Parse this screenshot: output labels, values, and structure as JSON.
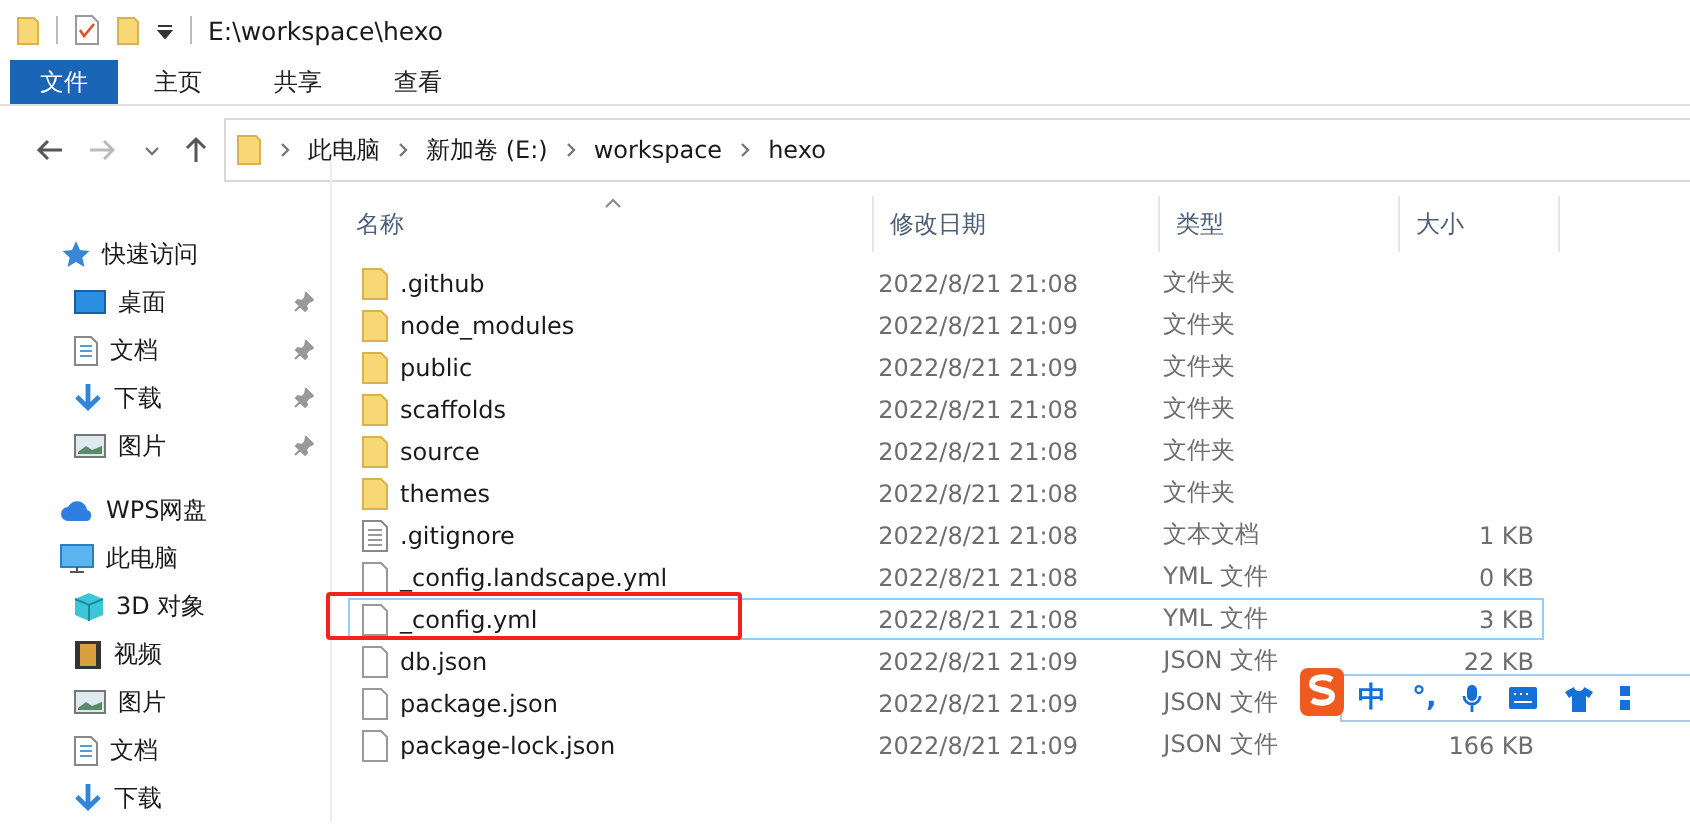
{
  "title_bar": {
    "path": "E:\\workspace\\hexo"
  },
  "ribbon_tabs": [
    {
      "label": "文件",
      "selected": true
    },
    {
      "label": "主页",
      "selected": false
    },
    {
      "label": "共享",
      "selected": false
    },
    {
      "label": "查看",
      "selected": false
    }
  ],
  "address_bar": {
    "crumbs": [
      "此电脑",
      "新加卷 (E:)",
      "workspace",
      "hexo"
    ]
  },
  "sidebar": {
    "items": [
      {
        "label": "快速访问",
        "kind": "star",
        "children": [
          {
            "label": "桌面",
            "kind": "desktop",
            "pinned": true
          },
          {
            "label": "文档",
            "kind": "document",
            "pinned": true
          },
          {
            "label": "下载",
            "kind": "download",
            "pinned": true
          },
          {
            "label": "图片",
            "kind": "image",
            "pinned": true
          }
        ]
      },
      {
        "label": "WPS网盘",
        "kind": "cloud"
      },
      {
        "label": "此电脑",
        "kind": "computer",
        "children": [
          {
            "label": "3D 对象",
            "kind": "cube",
            "pinned": false
          },
          {
            "label": "视频",
            "kind": "film",
            "pinned": false
          },
          {
            "label": "图片",
            "kind": "image",
            "pinned": false
          },
          {
            "label": "文档",
            "kind": "document",
            "pinned": false
          },
          {
            "label": "下载",
            "kind": "download",
            "pinned": false
          }
        ]
      }
    ]
  },
  "table": {
    "columns": [
      "名称",
      "修改日期",
      "类型",
      "大小"
    ],
    "rows": [
      {
        "name": ".github",
        "kind": "folder",
        "modified": "2022/8/21 21:08",
        "type": "文件夹",
        "selected": false
      },
      {
        "name": "node_modules",
        "kind": "folder",
        "modified": "2022/8/21 21:09",
        "type": "文件夹",
        "selected": false
      },
      {
        "name": "public",
        "kind": "folder",
        "modified": "2022/8/21 21:09",
        "type": "文件夹",
        "selected": false
      },
      {
        "name": "scaffolds",
        "kind": "folder",
        "modified": "2022/8/21 21:08",
        "type": "文件夹",
        "selected": false
      },
      {
        "name": "source",
        "kind": "folder",
        "modified": "2022/8/21 21:08",
        "type": "文件夹",
        "selected": false
      },
      {
        "name": "themes",
        "kind": "folder",
        "modified": "2022/8/21 21:08",
        "type": "文件夹",
        "selected": false
      },
      {
        "name": ".gitignore",
        "kind": "text",
        "modified": "2022/8/21 21:08",
        "type": "文本文档",
        "size": "1 KB",
        "selected": false
      },
      {
        "name": "_config.landscape.yml",
        "kind": "file",
        "modified": "2022/8/21 21:08",
        "type": "YML 文件",
        "size": "0 KB",
        "selected": false
      },
      {
        "name": "_config.yml",
        "kind": "file",
        "modified": "2022/8/21 21:08",
        "type": "YML 文件",
        "size": "3 KB",
        "selected": true
      },
      {
        "name": "db.json",
        "kind": "file",
        "modified": "2022/8/21 21:09",
        "type": "JSON 文件",
        "size": "22 KB",
        "selected": false
      },
      {
        "name": "package.json",
        "kind": "file",
        "modified": "2022/8/21 21:09",
        "type": "JSON 文件",
        "selected": false
      },
      {
        "name": "package-lock.json",
        "kind": "file",
        "modified": "2022/8/21 21:09",
        "type": "JSON 文件",
        "size": "166 KB",
        "selected": false
      }
    ]
  },
  "ime_toolbar": {
    "mode": "中",
    "punctuation": "°,"
  }
}
